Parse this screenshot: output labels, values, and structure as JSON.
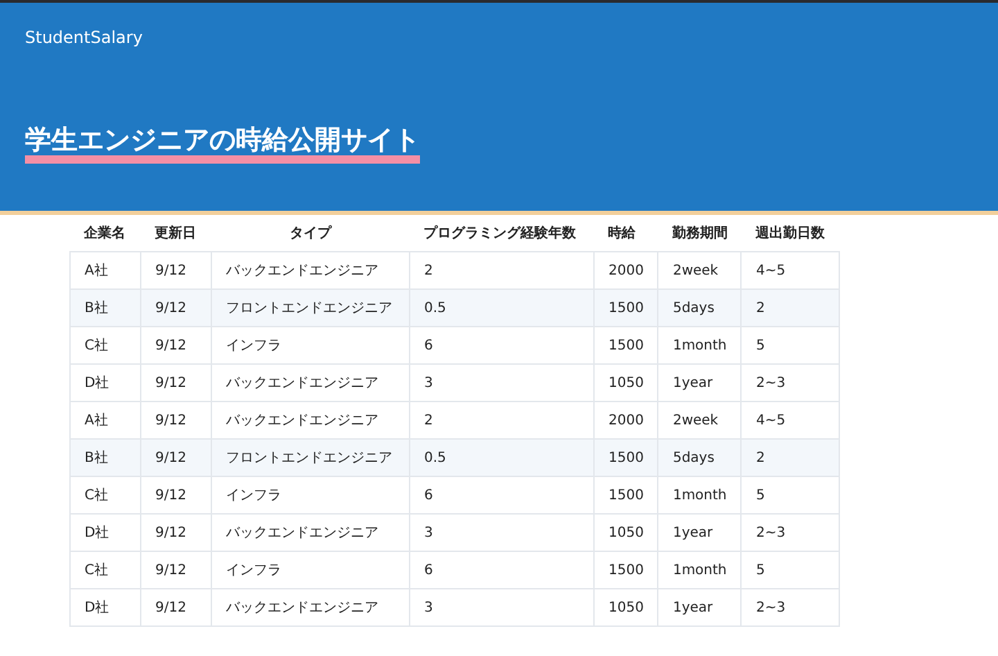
{
  "header": {
    "brand": "StudentSalary",
    "title": "学生エンジニアの時給公開サイト"
  },
  "table": {
    "columns": [
      "企業名",
      "更新日",
      "タイプ",
      "プログラミング経験年数",
      "時給",
      "勤務期間",
      "週出勤日数"
    ],
    "rows": [
      {
        "cells": [
          "A社",
          "9/12",
          "バックエンドエンジニア",
          "2",
          "2000",
          "2week",
          "4~5"
        ],
        "shaded": false
      },
      {
        "cells": [
          "B社",
          "9/12",
          "フロントエンドエンジニア",
          "0.5",
          "1500",
          "5days",
          "2"
        ],
        "shaded": true
      },
      {
        "cells": [
          "C社",
          "9/12",
          "インフラ",
          "6",
          "1500",
          "1month",
          "5"
        ],
        "shaded": false
      },
      {
        "cells": [
          "D社",
          "9/12",
          "バックエンドエンジニア",
          "3",
          "1050",
          "1year",
          "2~3"
        ],
        "shaded": false
      },
      {
        "cells": [
          "A社",
          "9/12",
          "バックエンドエンジニア",
          "2",
          "2000",
          "2week",
          "4~5"
        ],
        "shaded": false
      },
      {
        "cells": [
          "B社",
          "9/12",
          "フロントエンドエンジニア",
          "0.5",
          "1500",
          "5days",
          "2"
        ],
        "shaded": true
      },
      {
        "cells": [
          "C社",
          "9/12",
          "インフラ",
          "6",
          "1500",
          "1month",
          "5"
        ],
        "shaded": false
      },
      {
        "cells": [
          "D社",
          "9/12",
          "バックエンドエンジニア",
          "3",
          "1050",
          "1year",
          "2~3"
        ],
        "shaded": false
      },
      {
        "cells": [
          "C社",
          "9/12",
          "インフラ",
          "6",
          "1500",
          "1month",
          "5"
        ],
        "shaded": false
      },
      {
        "cells": [
          "D社",
          "9/12",
          "バックエンドエンジニア",
          "3",
          "1050",
          "1year",
          "2~3"
        ],
        "shaded": false
      }
    ]
  }
}
